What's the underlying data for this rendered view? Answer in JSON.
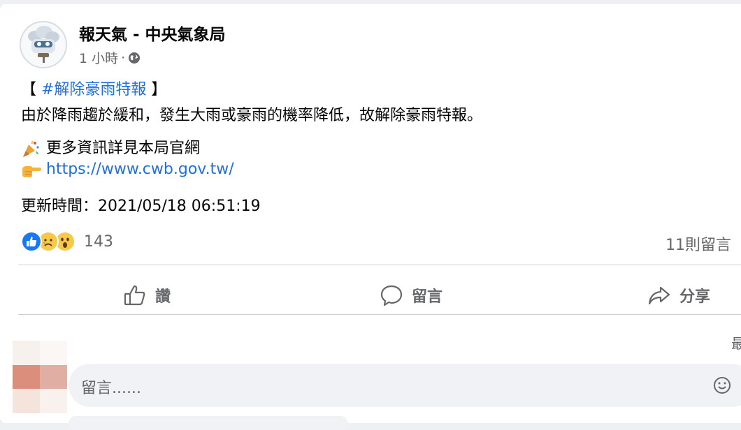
{
  "post": {
    "page_name": "報天氣 - 中央氣象局",
    "time": "1 小時",
    "meta_sep": "·",
    "privacy_icon": "globe-icon",
    "line1_open": "【 ",
    "line1_hashtag": "#解除豪雨特報",
    "line1_close": " 】",
    "line2": "由於降雨趨於緩和，發生大雨或豪雨的機率降低，故解除豪雨特報。",
    "line3": "更多資訊詳見本局官網",
    "line3_icon": "party-popper-icon",
    "line4_link": "https://www.cwb.gov.tw/",
    "line4_icon": "pointing-hand-icon",
    "line5": "更新時間：2021/05/18 06:51:19"
  },
  "reactions": {
    "types": [
      "like",
      "sad",
      "wow"
    ],
    "count": "143",
    "comment_count": "11則留言"
  },
  "actions": {
    "like_label": "讚",
    "comment_label": "留言",
    "share_label": "分享"
  },
  "comment_input": {
    "placeholder": "留言......",
    "emoji_icon": "smiley-icon",
    "edge_glyph": "最"
  },
  "colors": {
    "link": "#216fdb",
    "secondary_text": "#65676b",
    "like_blue": "#1877f2",
    "reaction_yellow": "#f7c948"
  }
}
